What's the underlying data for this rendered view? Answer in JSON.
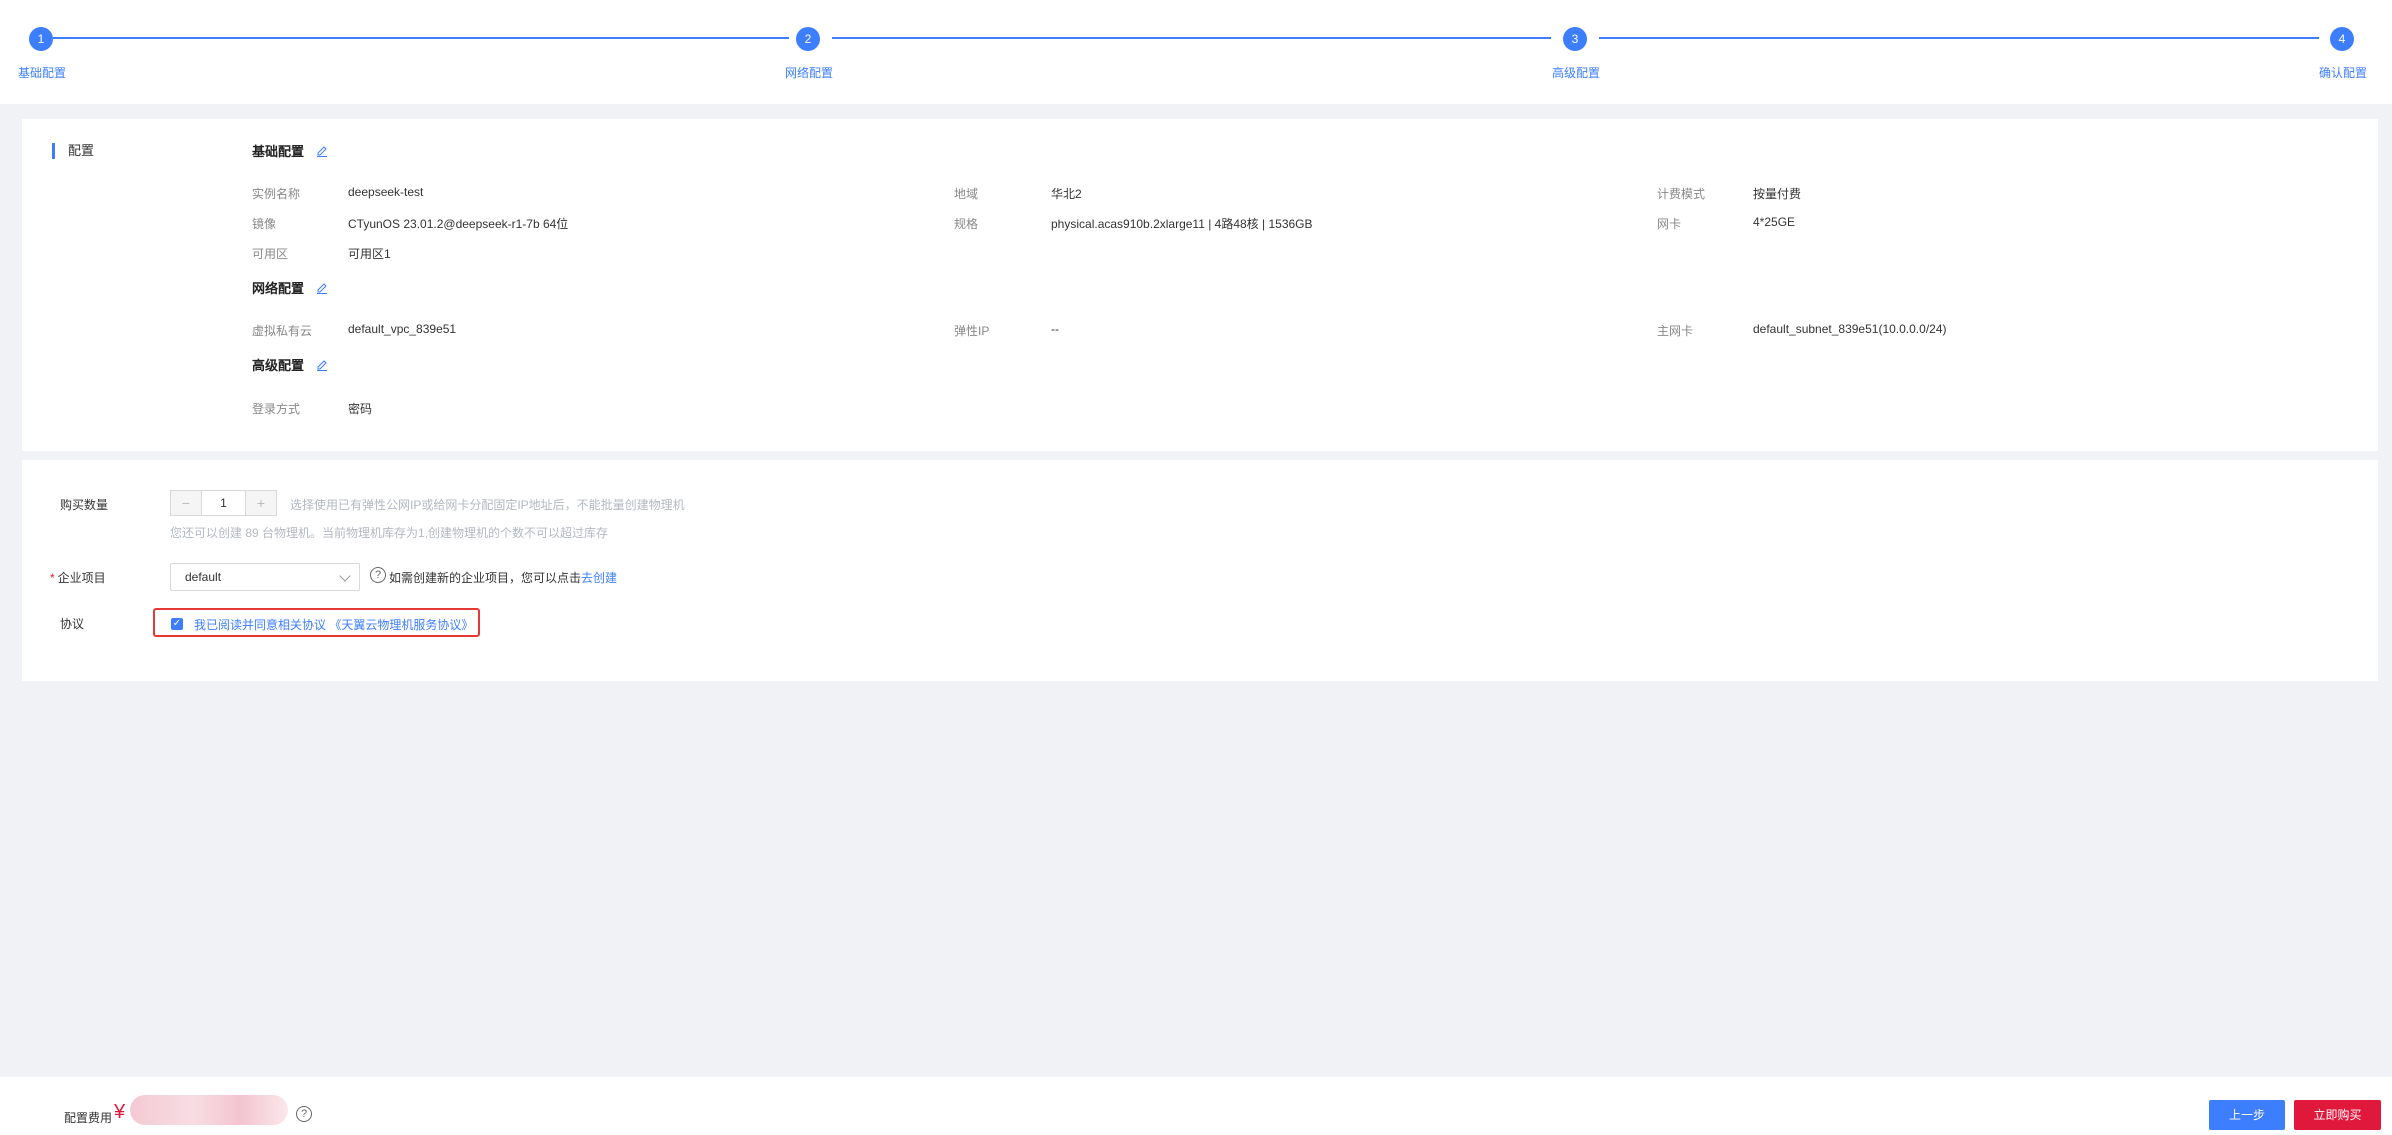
{
  "steps": [
    {
      "num": "1",
      "label": "基础配置"
    },
    {
      "num": "2",
      "label": "网络配置"
    },
    {
      "num": "3",
      "label": "高级配置"
    },
    {
      "num": "4",
      "label": "确认配置"
    }
  ],
  "summary": {
    "section_title": "配置",
    "basic": {
      "title": "基础配置",
      "instance_name_label": "实例名称",
      "instance_name": "deepseek-test",
      "region_label": "地域",
      "region": "华北2",
      "billing_label": "计费模式",
      "billing": "按量付费",
      "image_label": "镜像",
      "image": "CTyunOS 23.01.2@deepseek-r1-7b 64位",
      "spec_label": "规格",
      "spec": "physical.acas910b.2xlarge11 | 4路48核 | 1536GB",
      "nic_label": "网卡",
      "nic": "4*25GE",
      "az_label": "可用区",
      "az": "可用区1"
    },
    "network": {
      "title": "网络配置",
      "vpc_label": "虚拟私有云",
      "vpc": "default_vpc_839e51",
      "eip_label": "弹性IP",
      "eip": "--",
      "primary_nic_label": "主网卡",
      "primary_nic": "default_subnet_839e51(10.0.0.0/24)"
    },
    "advanced": {
      "title": "高级配置",
      "login_label": "登录方式",
      "login": "密码"
    }
  },
  "purchase": {
    "qty_label": "购买数量",
    "qty_minus": "−",
    "qty_value": "1",
    "qty_plus": "+",
    "qty_hint": "选择使用已有弹性公网IP或给网卡分配固定IP地址后，不能批量创建物理机",
    "qty_hint2": "您还可以创建 89 台物理机。当前物理机库存为1,创建物理机的个数不可以超过库存",
    "project_req": "*",
    "project_label": "企业项目",
    "project_value": "default",
    "project_hint": "如需创建新的企业项目，您可以点击",
    "project_link": "去创建",
    "agreement_label": "协议",
    "agreement_text": "我已阅读并同意相关协议 《天翼云物理机服务协议》",
    "agreement_checked": true
  },
  "footer": {
    "fee_label": "配置费用",
    "currency": "¥",
    "help_icon": "question-circle-icon",
    "prev_button": "上一步",
    "buy_button": "立即购买"
  },
  "colors": {
    "primary": "#3d7eff",
    "danger": "#e0183c",
    "highlight_border": "#e53935"
  }
}
